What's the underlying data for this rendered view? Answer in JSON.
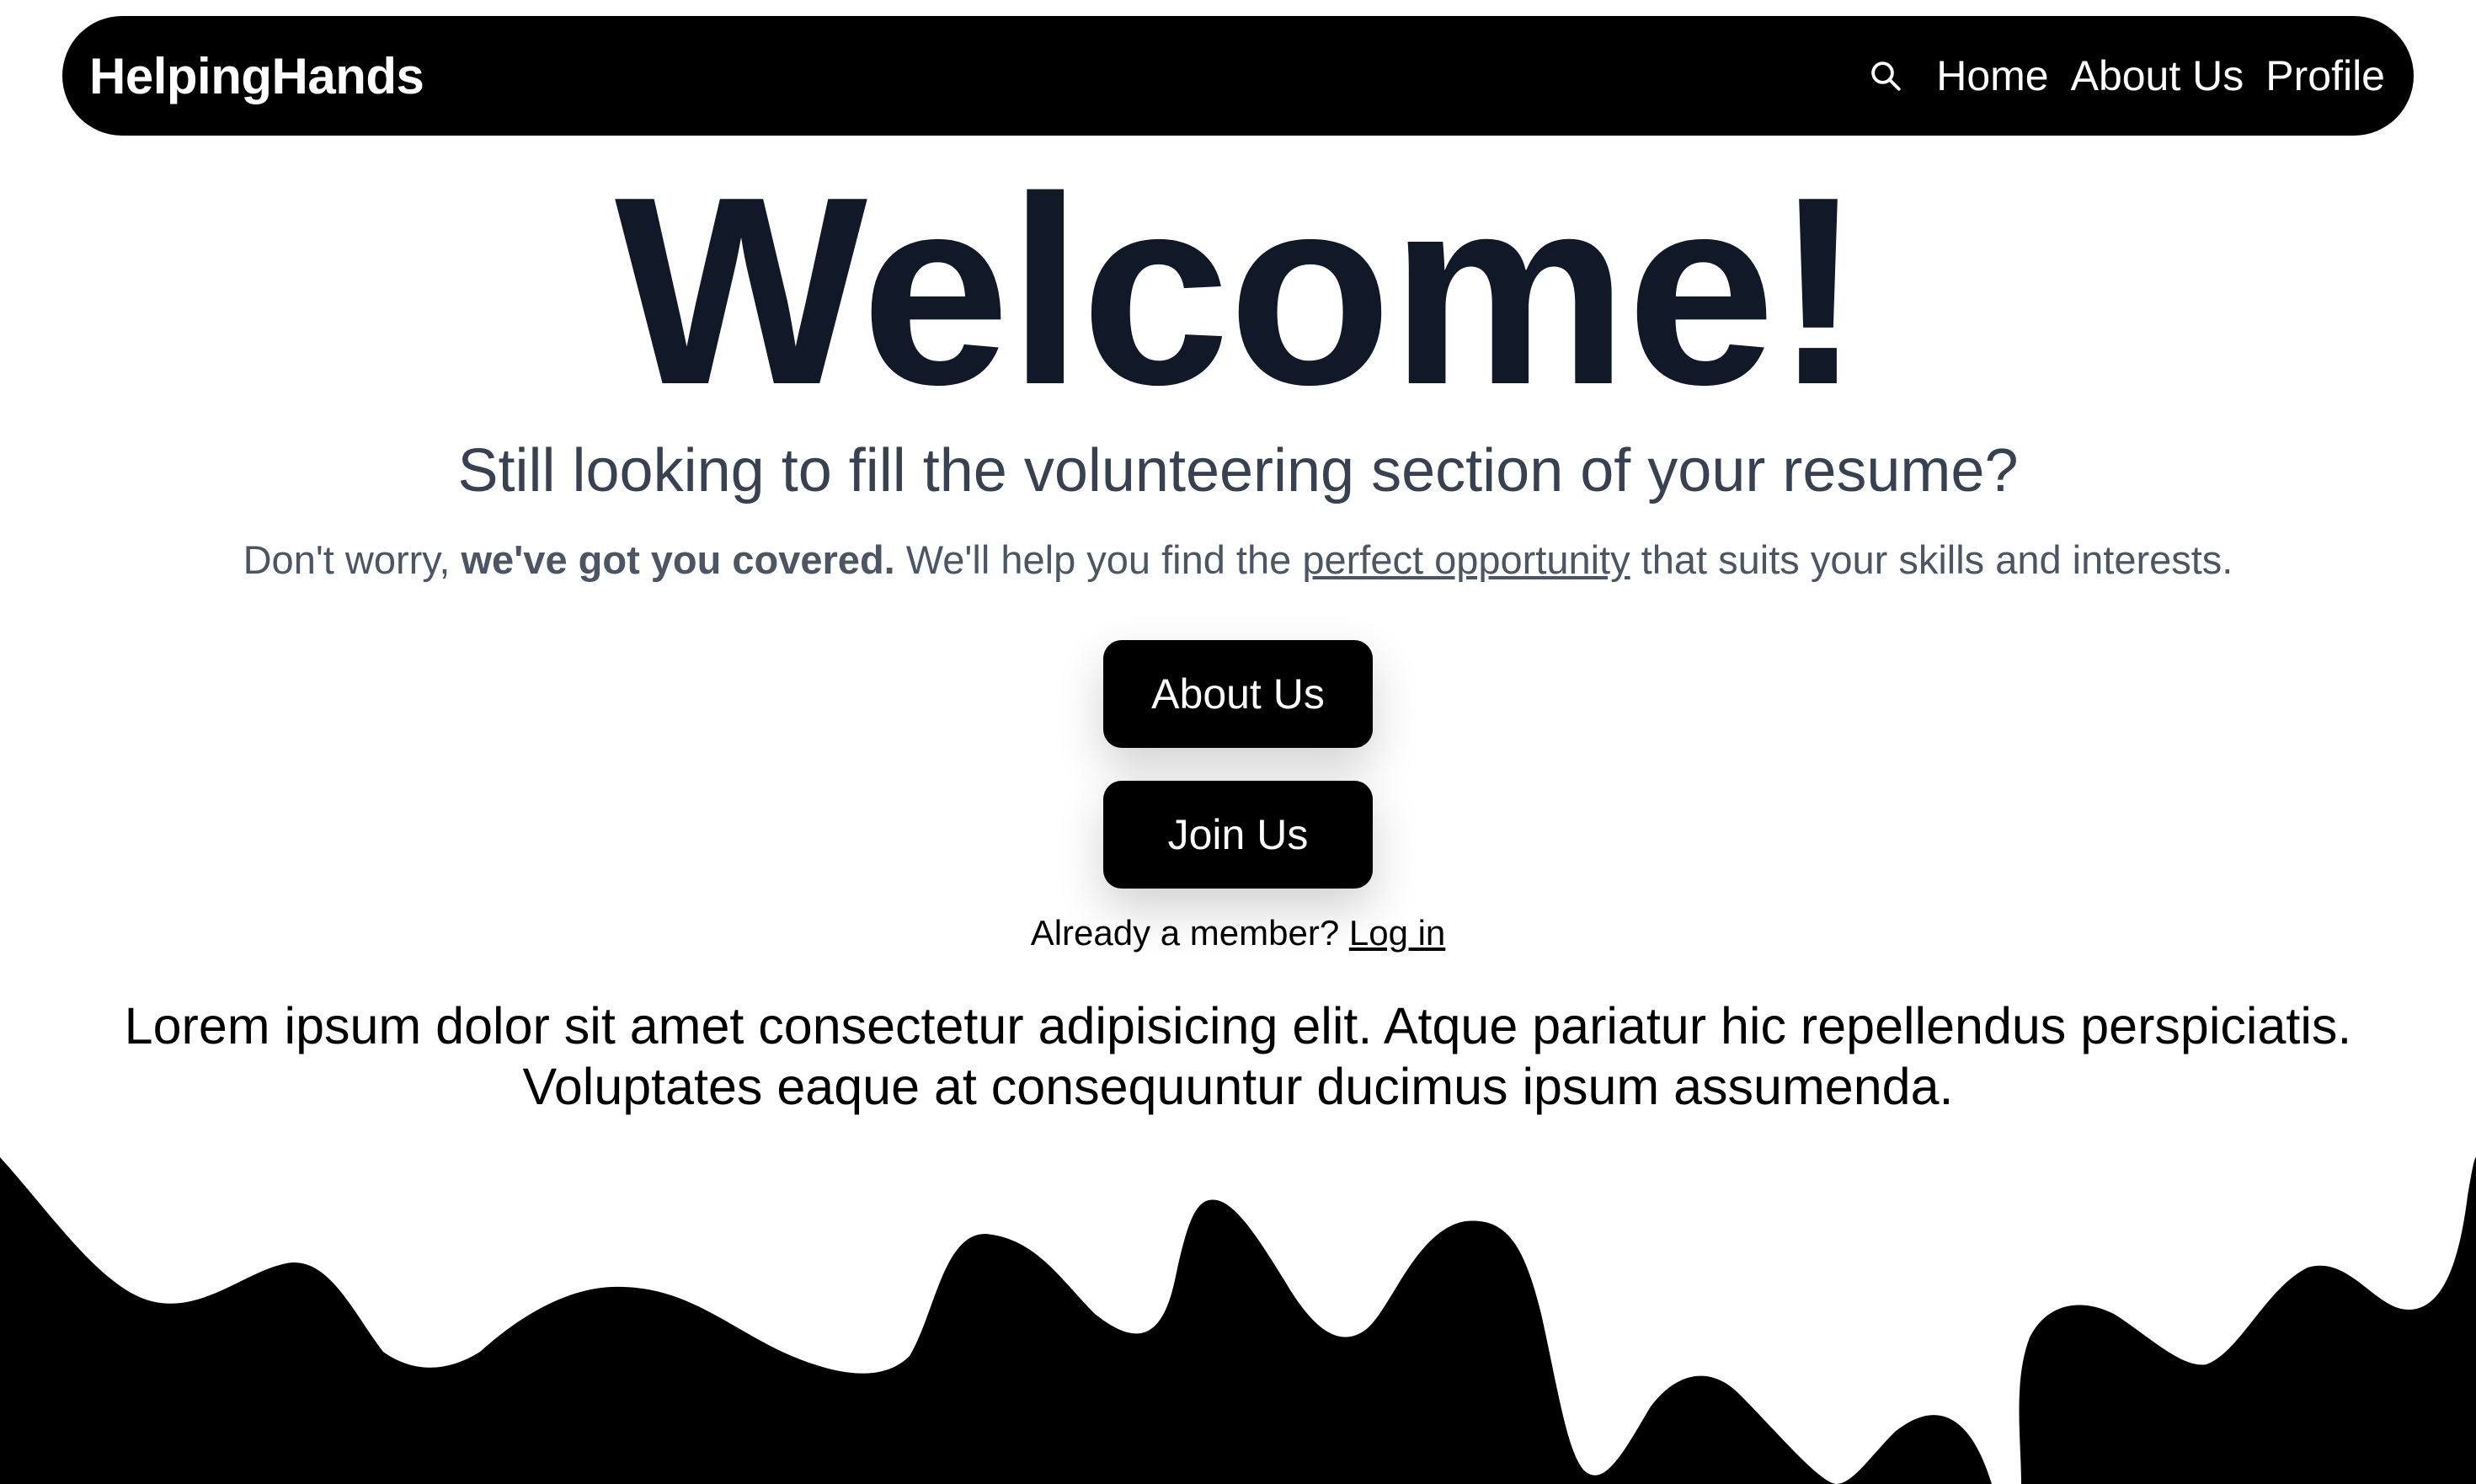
{
  "app": {
    "brand": "HelpingHands"
  },
  "nav": {
    "search_icon": "search-icon",
    "links": [
      "Home",
      "About Us",
      "Profile"
    ]
  },
  "hero": {
    "title": "Welcome!",
    "subtitle": "Still looking to fill the volunteering section of your resume?",
    "desc_part1": "Don't worry, ",
    "desc_bold": "we've got you covered.",
    "desc_part2": " We'll help you find the ",
    "desc_link": "perfect opportunity",
    "desc_part3": " that suits your skills and interests."
  },
  "buttons": {
    "about": "About Us",
    "join": "Join Us"
  },
  "member": {
    "prompt": "Already a member? ",
    "login": "Log in"
  },
  "lorem": {
    "line1": "Lorem ipsum dolor sit amet consectetur adipisicing elit. Atque pariatur hic repellendus perspiciatis.",
    "line2": "Voluptates eaque at consequuntur ducimus ipsum assumenda."
  },
  "colors": {
    "navbar_bg": "#000000",
    "title": "#111827",
    "subtitle": "#374151",
    "body_text": "#4b5563",
    "button_bg": "#000000",
    "wave": "#000000"
  }
}
